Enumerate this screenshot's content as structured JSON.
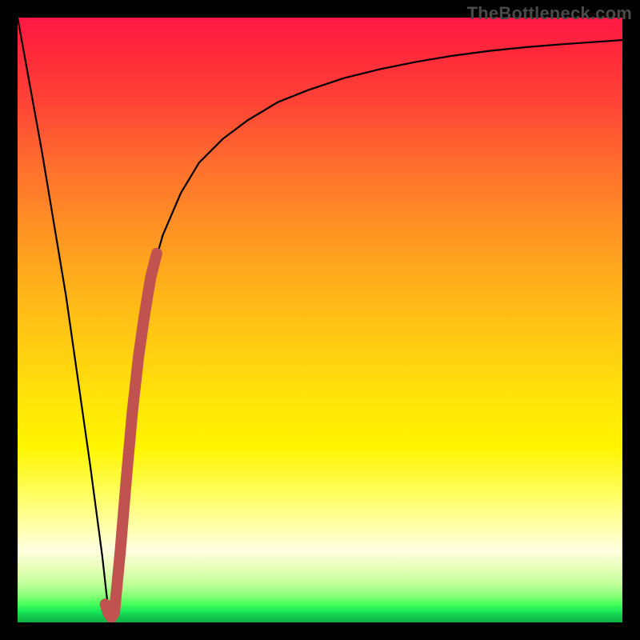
{
  "watermark": {
    "text": "TheBottleneck.com"
  },
  "colors": {
    "black_line": "#000000",
    "highlight": "#c0524f",
    "frame_bg": "#000000"
  },
  "chart_data": {
    "type": "line",
    "title": "",
    "xlabel": "",
    "ylabel": "",
    "xlim": [
      0,
      100
    ],
    "ylim": [
      0,
      100
    ],
    "grid": false,
    "legend": false,
    "series": [
      {
        "name": "bottleneck-curve",
        "color": "#000000",
        "x": [
          0,
          4,
          8,
          12,
          14,
          15,
          15.5,
          16,
          17,
          18,
          20,
          22,
          24,
          27,
          30,
          34,
          38,
          43,
          48,
          54,
          60,
          66,
          72,
          78,
          84,
          90,
          96,
          100
        ],
        "values": [
          100,
          78,
          54,
          26,
          11,
          2,
          0.5,
          2,
          14,
          26,
          46,
          57,
          64,
          71,
          76,
          80,
          83,
          86,
          88,
          90,
          91.5,
          92.7,
          93.7,
          94.5,
          95.1,
          95.6,
          96,
          96.3
        ]
      },
      {
        "name": "highlight-segment",
        "color": "#c0524f",
        "x": [
          14.5,
          15,
          15.5,
          16,
          17,
          18,
          19,
          20,
          21,
          22,
          23
        ],
        "values": [
          3,
          1.5,
          0.8,
          1.6,
          12,
          24,
          35,
          44,
          51,
          57,
          61
        ]
      }
    ],
    "annotations": []
  }
}
